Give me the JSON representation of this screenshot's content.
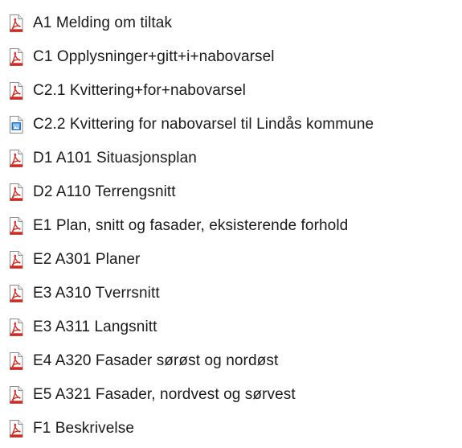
{
  "files": [
    {
      "name": "A1 Melding om tiltak",
      "icon": "pdf-file-icon"
    },
    {
      "name": "C1 Opplysninger+gitt+i+nabovarsel",
      "icon": "pdf-file-icon"
    },
    {
      "name": "C2.1 Kvittering+for+nabovarsel",
      "icon": "pdf-file-icon"
    },
    {
      "name": "C2.2 Kvittering for nabovarsel til Lindås kommune",
      "icon": "image-file-icon"
    },
    {
      "name": "D1 A101 Situasjonsplan",
      "icon": "pdf-file-icon"
    },
    {
      "name": "D2 A110 Terrengsnitt",
      "icon": "pdf-file-icon"
    },
    {
      "name": "E1 Plan, snitt og fasader, eksisterende forhold",
      "icon": "pdf-file-icon"
    },
    {
      "name": "E2 A301 Planer",
      "icon": "pdf-file-icon"
    },
    {
      "name": "E3 A310 Tverrsnitt",
      "icon": "pdf-file-icon"
    },
    {
      "name": "E3 A311 Langsnitt",
      "icon": "pdf-file-icon"
    },
    {
      "name": "E4 A320 Fasader sørøst og nordøst",
      "icon": "pdf-file-icon"
    },
    {
      "name": "E5 A321 Fasader, nordvest og sørvest",
      "icon": "pdf-file-icon"
    },
    {
      "name": "F1 Beskrivelse",
      "icon": "pdf-file-icon"
    }
  ],
  "colors": {
    "pdf_accent": "#d8261c",
    "image_accent": "#1f6fc4",
    "text": "#1a1a1a"
  }
}
